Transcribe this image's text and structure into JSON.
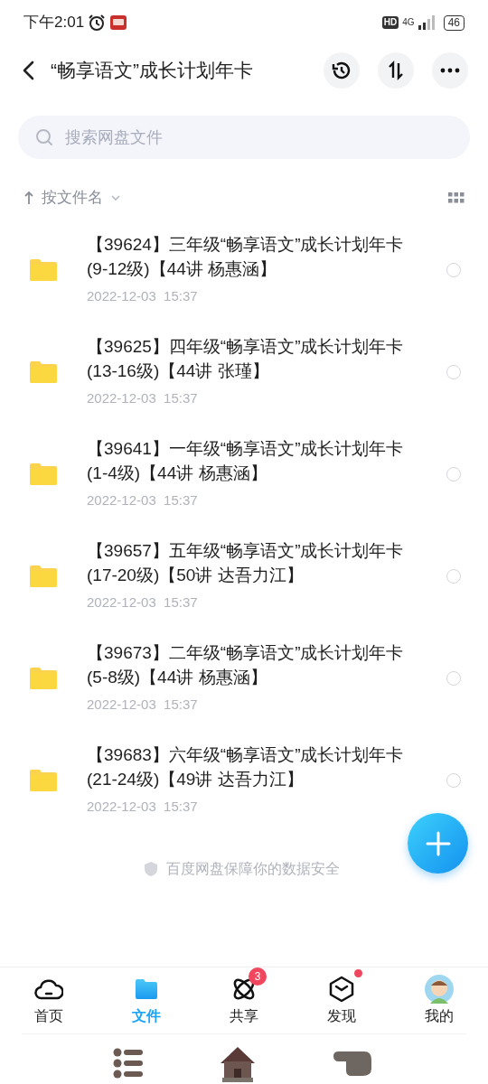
{
  "status_bar": {
    "time": "下午2:01",
    "hd": "HD",
    "network": "4G",
    "battery": "46"
  },
  "header": {
    "title": "“畅享语文”成长计划年卡"
  },
  "search": {
    "placeholder": "搜索网盘文件"
  },
  "sort": {
    "label": "按文件名"
  },
  "files": [
    {
      "name": "【39624】三年级“畅享语文”成长计划年卡(9-12级)【44讲 杨惠涵】",
      "date": "2022-12-03  15:37",
      "selected": false
    },
    {
      "name": "【39625】四年级“畅享语文”成长计划年卡(13-16级)【44讲 张瑾】",
      "date": "2022-12-03  15:37",
      "selected": false
    },
    {
      "name": "【39641】一年级“畅享语文”成长计划年卡(1-4级)【44讲 杨惠涵】",
      "date": "2022-12-03  15:37",
      "selected": false
    },
    {
      "name": "【39657】五年级“畅享语文”成长计划年卡(17-20级)【50讲 达吾力江】",
      "date": "2022-12-03  15:37",
      "selected": false
    },
    {
      "name": "【39673】二年级“畅享语文”成长计划年卡(5-8级)【44讲 杨惠涵】",
      "date": "2022-12-03  15:37",
      "selected": false
    },
    {
      "name": "【39683】六年级“畅享语文”成长计划年卡(21-24级)【49讲 达吾力江】",
      "date": "2022-12-03  15:37",
      "selected": false
    }
  ],
  "footer_note": "百度网盘保障你的数据安全",
  "tabs": [
    {
      "kind": "home",
      "label": "首页",
      "selected": false
    },
    {
      "kind": "files",
      "label": "文件",
      "selected": true
    },
    {
      "kind": "share",
      "label": "共享",
      "selected": false,
      "badge": "3"
    },
    {
      "kind": "discover",
      "label": "发现",
      "selected": false,
      "dot": true
    },
    {
      "kind": "me",
      "label": "我的",
      "selected": false
    }
  ]
}
